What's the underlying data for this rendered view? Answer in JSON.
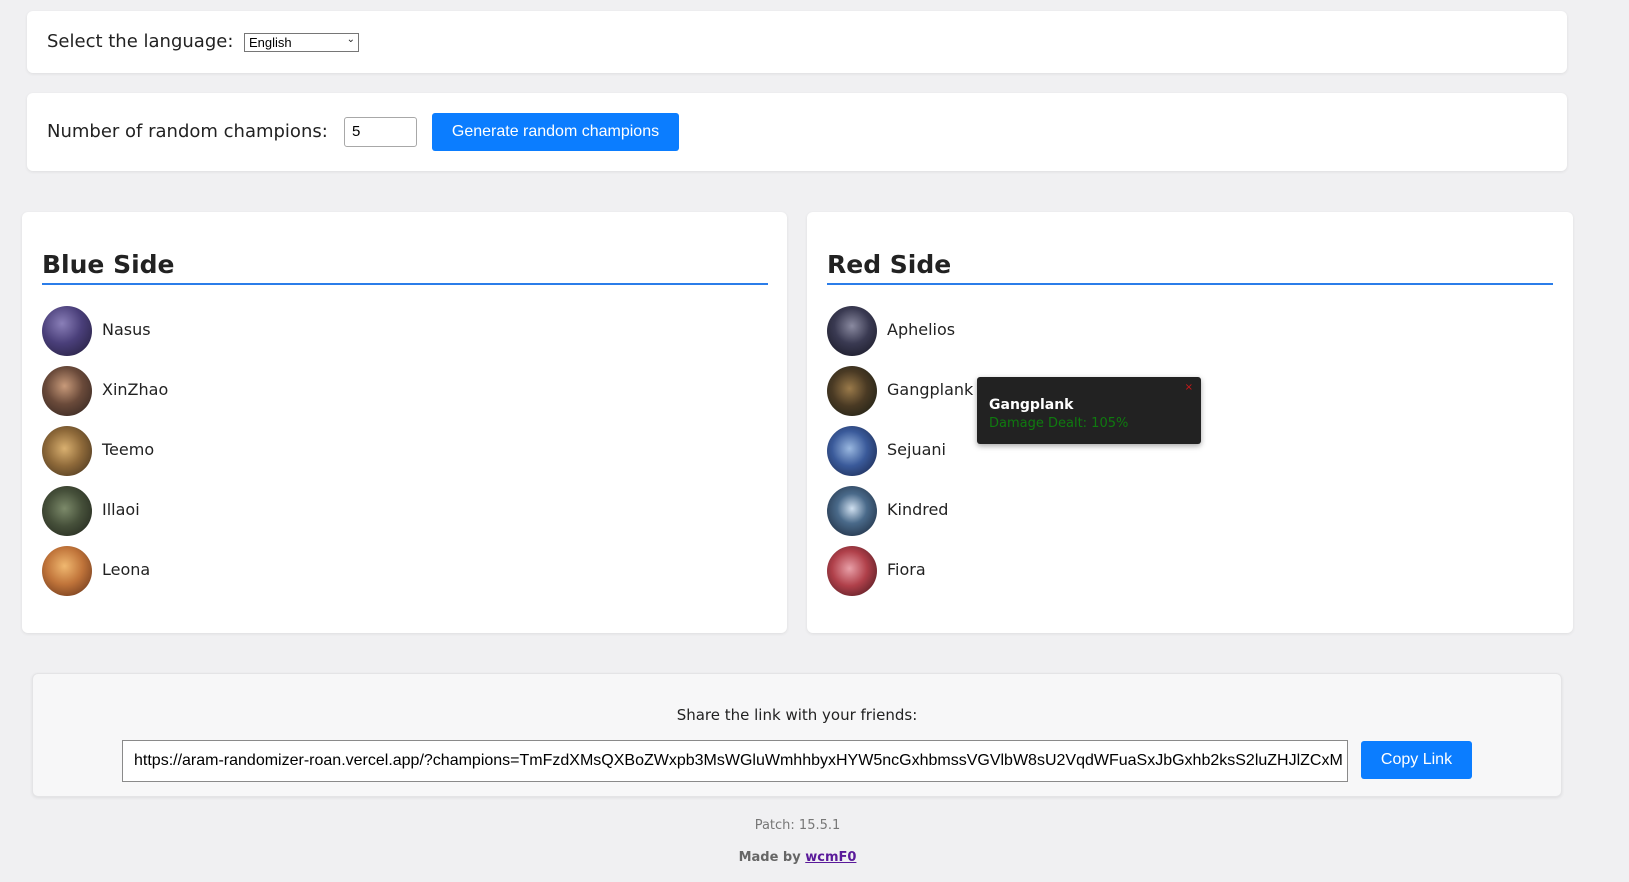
{
  "language": {
    "label": "Select the language:",
    "selected": "English"
  },
  "randomizer": {
    "label": "Number of random champions:",
    "count": "5",
    "generate_label": "Generate random champions"
  },
  "blue_side": {
    "title": "Blue Side",
    "champions": [
      {
        "name": "Nasus"
      },
      {
        "name": "XinZhao"
      },
      {
        "name": "Teemo"
      },
      {
        "name": "Illaoi"
      },
      {
        "name": "Leona"
      }
    ]
  },
  "red_side": {
    "title": "Red Side",
    "champions": [
      {
        "name": "Aphelios"
      },
      {
        "name": "Gangplank"
      },
      {
        "name": "Sejuani"
      },
      {
        "name": "Kindred"
      },
      {
        "name": "Fiora"
      }
    ]
  },
  "tooltip": {
    "title": "Gangplank",
    "stat": "Damage Dealt: 105%",
    "close": "×"
  },
  "share": {
    "label": "Share the link with your friends:",
    "url": "https://aram-randomizer-roan.vercel.app/?champions=TmFzdXMsQXBoZWxpb3MsWGluWmhhbyxHYW5ncGxhbmssVGVlbW8sU2VqdWFuaSxJbGxhb2ksS2luZHJlZCxM",
    "copy_label": "Copy Link"
  },
  "footer": {
    "patch": "Patch: 15.5.1",
    "made_by": "Made by",
    "author": "wcmF0"
  },
  "colors": {
    "accent": "#0b7dff",
    "divider": "#2b7de9",
    "tooltip_stat": "#0f7a0f"
  }
}
